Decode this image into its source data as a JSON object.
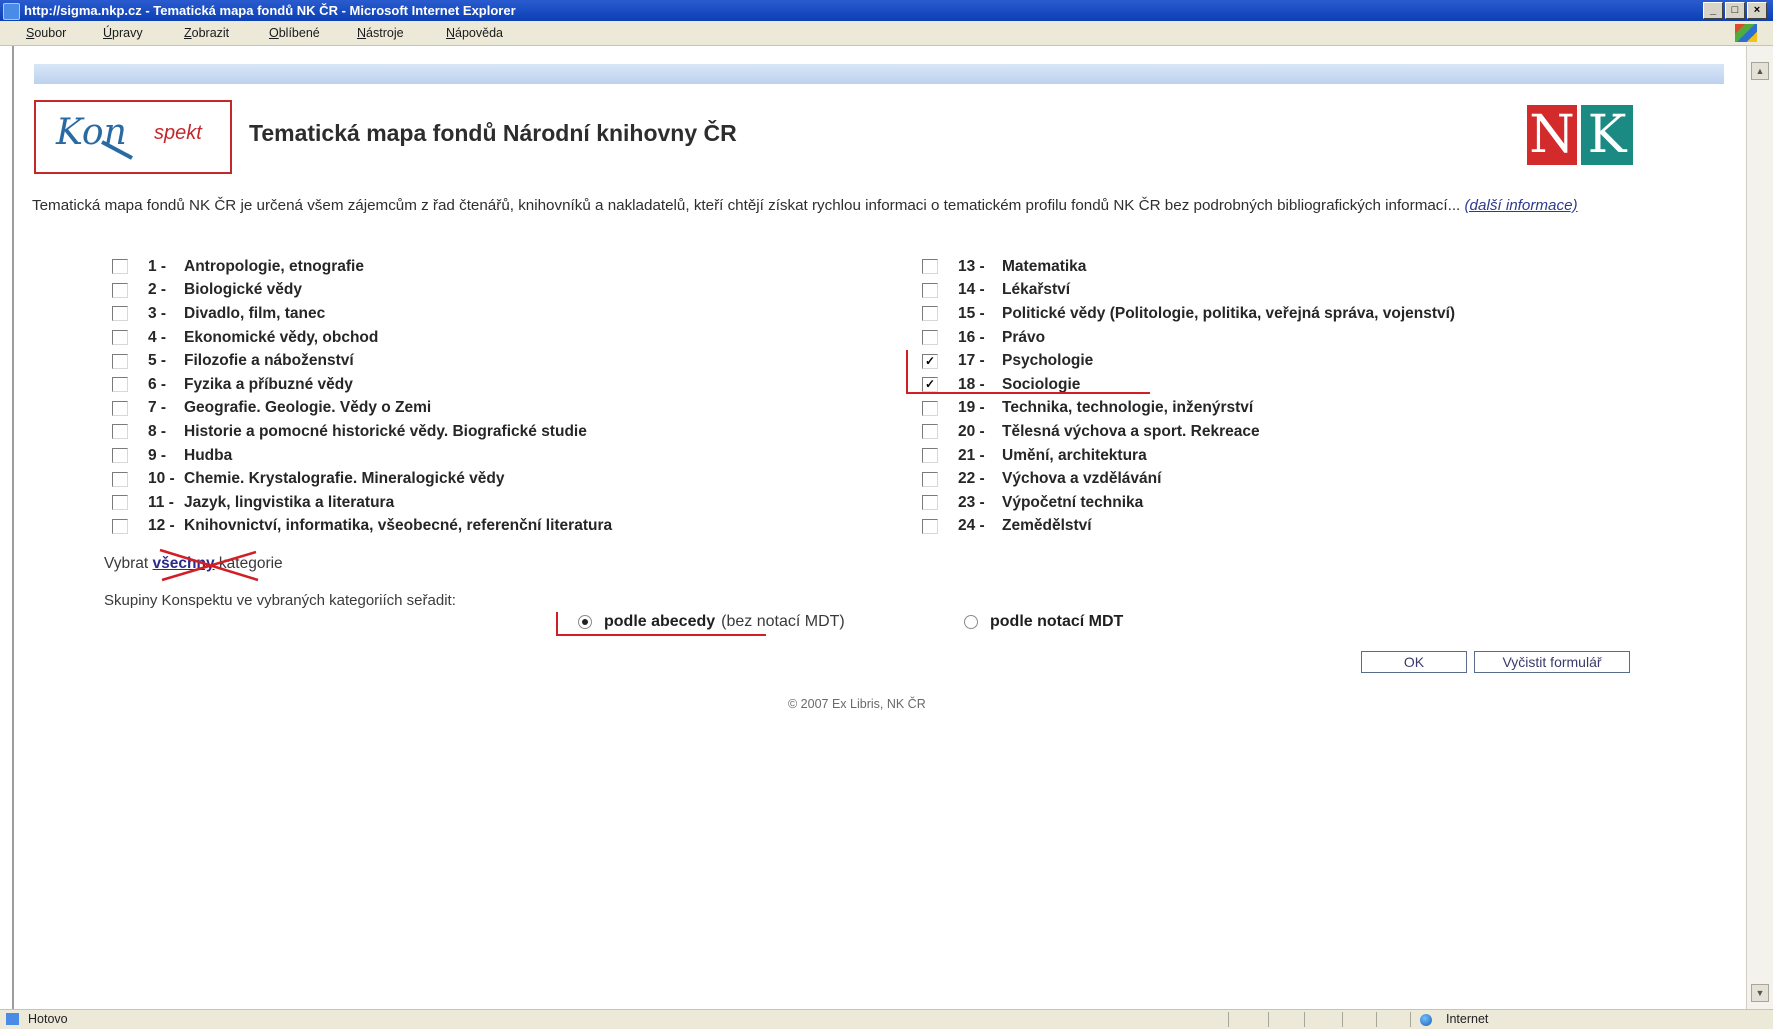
{
  "window": {
    "title": "http://sigma.nkp.cz - Tematická mapa fondů NK ČR - Microsoft Internet Explorer",
    "min": "_",
    "max": "□",
    "close": "×"
  },
  "menu": [
    "Soubor",
    "Úpravy",
    "Zobrazit",
    "Oblíbené",
    "Nástroje",
    "Nápověda"
  ],
  "logos": {
    "konspekt_main": "Kon",
    "konspekt_tail": "spekt",
    "nk_left": "N",
    "nk_right": "K"
  },
  "page": {
    "title": "Tematická mapa fondů Národní knihovny ČR",
    "intro": "Tematická mapa fondů NK ČR je určená všem zájemcům z řad čtenářů, knihovníků a nakladatelů, kteří chtějí získat rychlou informaci o tematickém profilu fondů NK ČR bez podrobných bibliografických informací...",
    "intro_link": "(další informace)"
  },
  "categories_left": [
    {
      "num": "1 -",
      "label": "Antropologie, etnografie",
      "checked": false
    },
    {
      "num": "2 -",
      "label": "Biologické vědy",
      "checked": false
    },
    {
      "num": "3 -",
      "label": "Divadlo, film, tanec",
      "checked": false
    },
    {
      "num": "4 -",
      "label": "Ekonomické vědy, obchod",
      "checked": false
    },
    {
      "num": "5 -",
      "label": "Filozofie a náboženství",
      "checked": false
    },
    {
      "num": "6 -",
      "label": "Fyzika a příbuzné vědy",
      "checked": false
    },
    {
      "num": "7 -",
      "label": "Geografie. Geologie. Vědy o Zemi",
      "checked": false
    },
    {
      "num": "8 -",
      "label": "Historie a pomocné historické vědy. Biografické studie",
      "checked": false
    },
    {
      "num": "9 -",
      "label": "Hudba",
      "checked": false
    },
    {
      "num": "10 -",
      "label": "Chemie. Krystalografie. Mineralogické vědy",
      "checked": false
    },
    {
      "num": "11 -",
      "label": "Jazyk, lingvistika a literatura",
      "checked": false
    },
    {
      "num": "12 -",
      "label": "Knihovnictví, informatika, všeobecné, referenční literatura",
      "checked": false
    }
  ],
  "categories_right": [
    {
      "num": "13 -",
      "label": "Matematika",
      "checked": false
    },
    {
      "num": "14 -",
      "label": "Lékařství",
      "checked": false
    },
    {
      "num": "15 -",
      "label": "Politické vědy (Politologie, politika, veřejná správa, vojenství)",
      "checked": false
    },
    {
      "num": "16 -",
      "label": "Právo",
      "checked": false
    },
    {
      "num": "17 -",
      "label": "Psychologie",
      "checked": true
    },
    {
      "num": "18 -",
      "label": "Sociologie",
      "checked": true
    },
    {
      "num": "19 -",
      "label": "Technika, technologie, inženýrství",
      "checked": false
    },
    {
      "num": "20 -",
      "label": "Tělesná výchova a sport. Rekreace",
      "checked": false
    },
    {
      "num": "21 -",
      "label": "Umění, architektura",
      "checked": false
    },
    {
      "num": "22 -",
      "label": "Výchova a vzdělávání",
      "checked": false
    },
    {
      "num": "23 -",
      "label": "Výpočetní technika",
      "checked": false
    },
    {
      "num": "24 -",
      "label": "Zemědělství",
      "checked": false
    }
  ],
  "select_all": {
    "before": "Vybrat",
    "link": "všechny",
    "after": "kategorie"
  },
  "sort": {
    "label": "Skupiny Konspektu ve vybraných kategoriích seřadit:",
    "option1_bold": "podle abecedy",
    "option1_rest": "(bez notací MDT)",
    "option1_selected": true,
    "option2_bold": "podle notací MDT",
    "option2_selected": false
  },
  "buttons": {
    "ok": "OK",
    "clear": "Vyčistit formulář"
  },
  "footer": "© 2007 Ex Libris, NK ČR",
  "status": {
    "left": "Hotovo",
    "zone": "Internet"
  },
  "colors": {
    "title_bar": "#0b3fb4",
    "annotation_red": "#d01f25",
    "nk_red": "#d32b2b",
    "nk_teal": "#1a8a83"
  }
}
